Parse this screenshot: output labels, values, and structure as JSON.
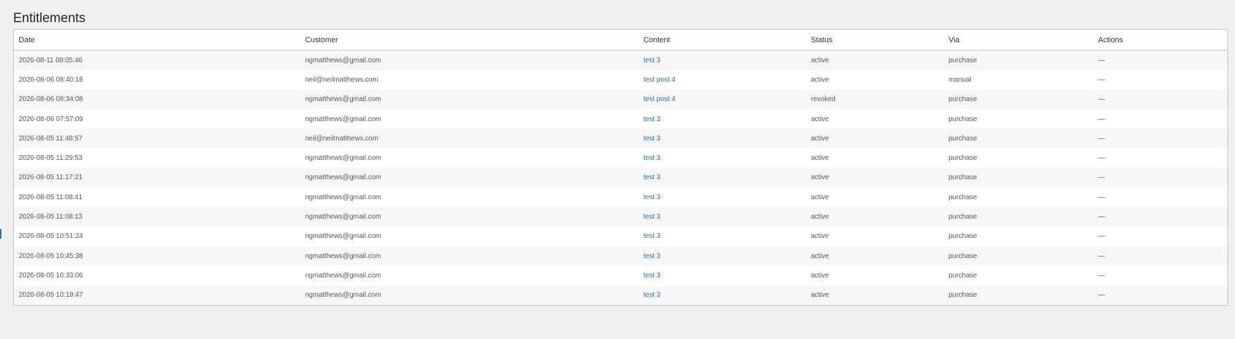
{
  "page": {
    "title": "Entitlements"
  },
  "colors": {
    "background": "#f0f0f1",
    "table_background": "#ffffff",
    "stripe": "#f6f7f7",
    "border": "#c3c4c7",
    "link": "#2271b1"
  },
  "table": {
    "columns": [
      "Date",
      "Customer",
      "Content",
      "Status",
      "Via",
      "Actions"
    ],
    "rows": [
      {
        "date": "2026-08-11 08:05:46",
        "customer": "ngmatthews@gmail.com",
        "content": "test 3",
        "status": "active",
        "via": "purchase",
        "actions": "—"
      },
      {
        "date": "2026-08-06 08:40:18",
        "customer": "neil@neilmatthews.com",
        "content": "test post 4",
        "status": "active",
        "via": "manual",
        "actions": "—"
      },
      {
        "date": "2026-08-06 08:34:08",
        "customer": "ngmatthews@gmail.com",
        "content": "test post 4",
        "status": "revoked",
        "via": "purchase",
        "actions": "—"
      },
      {
        "date": "2026-08-06 07:57:09",
        "customer": "ngmatthews@gmail.com",
        "content": "test 3",
        "status": "active",
        "via": "purchase",
        "actions": "—"
      },
      {
        "date": "2026-08-05 11:48:57",
        "customer": "neil@neilmatthews.com",
        "content": "test 3",
        "status": "active",
        "via": "purchase",
        "actions": "—"
      },
      {
        "date": "2026-08-05 11:29:53",
        "customer": "ngmatthews@gmail.com",
        "content": "test 3",
        "status": "active",
        "via": "purchase",
        "actions": "—"
      },
      {
        "date": "2026-08-05 11:17:21",
        "customer": "ngmatthews@gmail.com",
        "content": "test 3",
        "status": "active",
        "via": "purchase",
        "actions": "—"
      },
      {
        "date": "2026-08-05 11:08:41",
        "customer": "ngmatthews@gmail.com",
        "content": "test 3",
        "status": "active",
        "via": "purchase",
        "actions": "—"
      },
      {
        "date": "2026-08-05 11:08:13",
        "customer": "ngmatthews@gmail.com",
        "content": "test 3",
        "status": "active",
        "via": "purchase",
        "actions": "—"
      },
      {
        "date": "2026-08-05 10:51:24",
        "customer": "ngmatthews@gmail.com",
        "content": "test 3",
        "status": "active",
        "via": "purchase",
        "actions": "—"
      },
      {
        "date": "2026-08-05 10:45:38",
        "customer": "ngmatthews@gmail.com",
        "content": "test 3",
        "status": "active",
        "via": "purchase",
        "actions": "—"
      },
      {
        "date": "2026-08-05 10:33:06",
        "customer": "ngmatthews@gmail.com",
        "content": "test 3",
        "status": "active",
        "via": "purchase",
        "actions": "—"
      },
      {
        "date": "2026-08-05 10:19:47",
        "customer": "ngmatthews@gmail.com",
        "content": "test 3",
        "status": "active",
        "via": "purchase",
        "actions": "—"
      }
    ]
  }
}
